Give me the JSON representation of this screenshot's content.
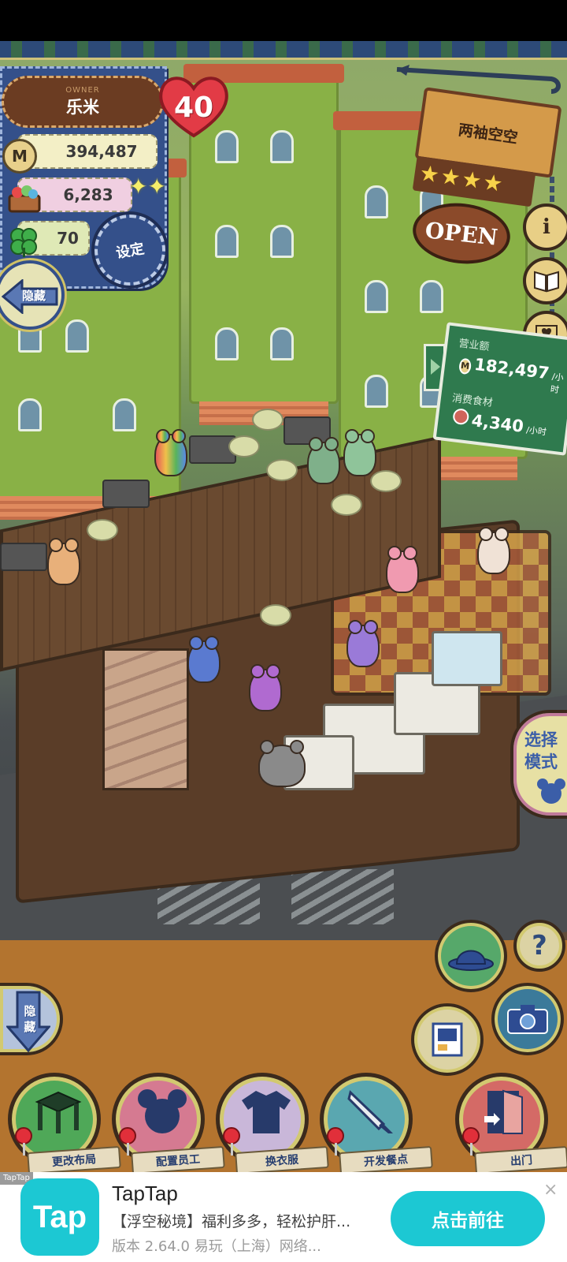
{
  "owner": {
    "tag": "OWNER",
    "name": "乐米",
    "hearts": "40"
  },
  "stats": {
    "coins": "394,487",
    "food": "6,283",
    "clover": "70"
  },
  "buttons": {
    "settings": "设定",
    "hide": "隐藏",
    "hide_vertical": "隐藏",
    "select_mode": "选择模式"
  },
  "shop": {
    "name": "两袖空空",
    "stars": 4,
    "status": "OPEN"
  },
  "side_icons": {
    "info": "i",
    "help": "?"
  },
  "revenue": {
    "sales_label": "营业额",
    "sales_value": "182,497",
    "sales_unit": "/小时",
    "food_label": "消费食材",
    "food_value": "4,340",
    "food_unit": "/小时"
  },
  "actions": [
    {
      "label": "更改布局"
    },
    {
      "label": "配置员工"
    },
    {
      "label": "换衣服"
    },
    {
      "label": "开发餐点"
    },
    {
      "label": "出门"
    }
  ],
  "ad": {
    "tag": "TapTap",
    "logo": "Tap",
    "title": "TapTap",
    "description": "【浮空秘境】福利多多，轻松护肝...",
    "version": "版本 2.64.0  易玩（上海）网络...",
    "button": "点击前往",
    "close": "×"
  },
  "colors": {
    "accent": "#1cc8d3",
    "panel": "#34508a",
    "sign_board": "#2f7a4e"
  }
}
